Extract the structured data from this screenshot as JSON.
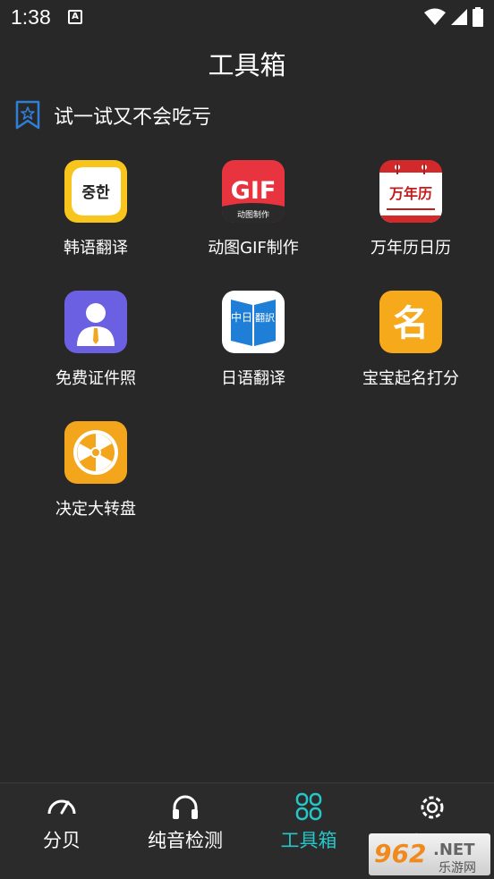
{
  "status_bar": {
    "time": "1:38",
    "notification_glyph": "A"
  },
  "page_title": "工具箱",
  "section_label": "试一试又不会吃亏",
  "tools": [
    {
      "label": "韩语翻译",
      "icon": "korean-translate-icon",
      "icon_text": "중한"
    },
    {
      "label": "动图GIF制作",
      "icon": "gif-maker-icon",
      "icon_text": "GIF",
      "icon_subtext": "动图制作"
    },
    {
      "label": "万年历日历",
      "icon": "calendar-icon",
      "icon_text": "万年历"
    },
    {
      "label": "免费证件照",
      "icon": "id-photo-icon"
    },
    {
      "label": "日语翻译",
      "icon": "japanese-translate-icon",
      "icon_text_a": "中日",
      "icon_text_b": "翻訳"
    },
    {
      "label": "宝宝起名打分",
      "icon": "baby-naming-icon",
      "icon_text": "名"
    },
    {
      "label": "决定大转盘",
      "icon": "spin-wheel-icon"
    }
  ],
  "tabs": [
    {
      "label": "分贝",
      "icon": "gauge-icon",
      "active": false
    },
    {
      "label": "纯音检测",
      "icon": "headphones-icon",
      "active": false
    },
    {
      "label": "工具箱",
      "icon": "toolbox-grid-icon",
      "active": true
    },
    {
      "label": "设置",
      "icon": "gear-icon",
      "active": false
    }
  ],
  "watermark": {
    "text_a": "962",
    "text_b": ".NET",
    "text_c": "乐游网"
  },
  "colors": {
    "background": "#282828",
    "active_tab": "#26c6c9",
    "accent_blue": "#2f7fd8"
  }
}
